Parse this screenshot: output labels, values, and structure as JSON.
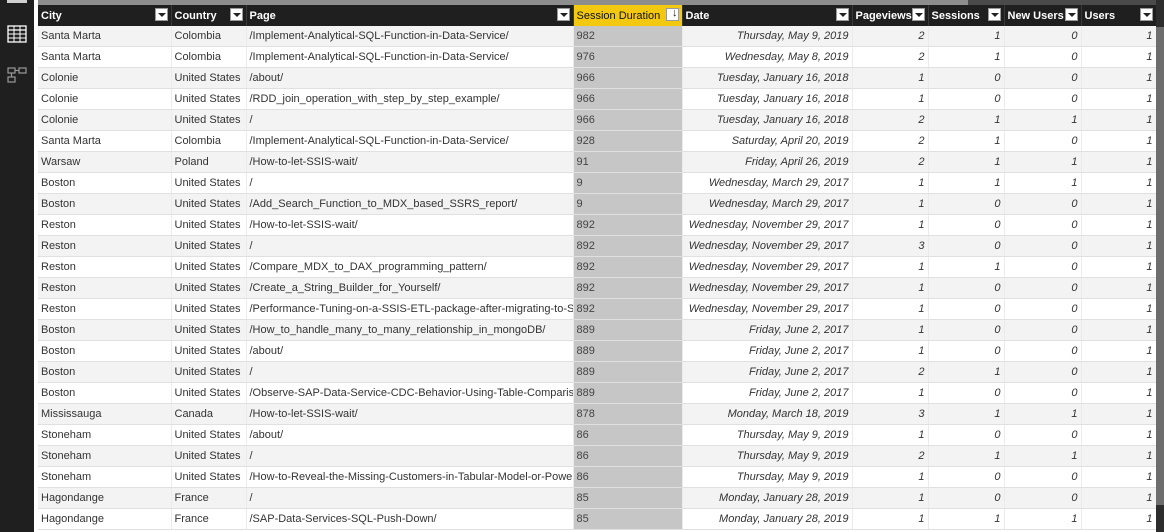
{
  "columns": [
    {
      "key": "city",
      "label": "City",
      "width": 133
    },
    {
      "key": "country",
      "label": "Country",
      "width": 75
    },
    {
      "key": "page",
      "label": "Page",
      "width": 327
    },
    {
      "key": "session_duration",
      "label": "Session Duration",
      "width": 109
    },
    {
      "key": "date",
      "label": "Date",
      "width": 170
    },
    {
      "key": "pageviews",
      "label": "Pageviews",
      "width": 76
    },
    {
      "key": "sessions",
      "label": "Sessions",
      "width": 76
    },
    {
      "key": "new_users",
      "label": "New Users",
      "width": 77
    },
    {
      "key": "users",
      "label": "Users",
      "width": 75
    }
  ],
  "sorted_column": "session_duration",
  "sort_direction": "descending",
  "rows": [
    [
      "Santa Marta",
      "Colombia",
      "/Implement-Analytical-SQL-Function-in-Data-Service/",
      "982",
      "Thursday, May 9, 2019",
      "2",
      "1",
      "0",
      "1"
    ],
    [
      "Santa Marta",
      "Colombia",
      "/Implement-Analytical-SQL-Function-in-Data-Service/",
      "976",
      "Wednesday, May 8, 2019",
      "2",
      "1",
      "0",
      "1"
    ],
    [
      "Colonie",
      "United States",
      "/about/",
      "966",
      "Tuesday, January 16, 2018",
      "1",
      "0",
      "0",
      "1"
    ],
    [
      "Colonie",
      "United States",
      "/RDD_join_operation_with_step_by_step_example/",
      "966",
      "Tuesday, January 16, 2018",
      "1",
      "0",
      "0",
      "1"
    ],
    [
      "Colonie",
      "United States",
      "/",
      "966",
      "Tuesday, January 16, 2018",
      "2",
      "1",
      "1",
      "1"
    ],
    [
      "Santa Marta",
      "Colombia",
      "/Implement-Analytical-SQL-Function-in-Data-Service/",
      "928",
      "Saturday, April 20, 2019",
      "2",
      "1",
      "0",
      "1"
    ],
    [
      "Warsaw",
      "Poland",
      "/How-to-let-SSIS-wait/",
      "91",
      "Friday, April 26, 2019",
      "2",
      "1",
      "1",
      "1"
    ],
    [
      "Boston",
      "United States",
      "/",
      "9",
      "Wednesday, March 29, 2017",
      "1",
      "1",
      "1",
      "1"
    ],
    [
      "Boston",
      "United States",
      "/Add_Search_Function_to_MDX_based_SSRS_report/",
      "9",
      "Wednesday, March 29, 2017",
      "1",
      "0",
      "0",
      "1"
    ],
    [
      "Reston",
      "United States",
      "/How-to-let-SSIS-wait/",
      "892",
      "Wednesday, November 29, 2017",
      "1",
      "0",
      "0",
      "1"
    ],
    [
      "Reston",
      "United States",
      "/",
      "892",
      "Wednesday, November 29, 2017",
      "3",
      "0",
      "0",
      "1"
    ],
    [
      "Reston",
      "United States",
      "/Compare_MDX_to_DAX_programming_pattern/",
      "892",
      "Wednesday, November 29, 2017",
      "1",
      "1",
      "0",
      "1"
    ],
    [
      "Reston",
      "United States",
      "/Create_a_String_Builder_for_Yourself/",
      "892",
      "Wednesday, November 29, 2017",
      "1",
      "0",
      "0",
      "1"
    ],
    [
      "Reston",
      "United States",
      "/Performance-Tuning-on-a-SSIS-ETL-package-after-migrating-to-SC",
      "892",
      "Wednesday, November 29, 2017",
      "1",
      "0",
      "0",
      "1"
    ],
    [
      "Boston",
      "United States",
      "/How_to_handle_many_to_many_relationship_in_mongoDB/",
      "889",
      "Friday, June 2, 2017",
      "1",
      "0",
      "0",
      "1"
    ],
    [
      "Boston",
      "United States",
      "/about/",
      "889",
      "Friday, June 2, 2017",
      "1",
      "0",
      "0",
      "1"
    ],
    [
      "Boston",
      "United States",
      "/",
      "889",
      "Friday, June 2, 2017",
      "2",
      "1",
      "0",
      "1"
    ],
    [
      "Boston",
      "United States",
      "/Observe-SAP-Data-Service-CDC-Behavior-Using-Table-Comparison",
      "889",
      "Friday, June 2, 2017",
      "1",
      "0",
      "0",
      "1"
    ],
    [
      "Mississauga",
      "Canada",
      "/How-to-let-SSIS-wait/",
      "878",
      "Monday, March 18, 2019",
      "3",
      "1",
      "1",
      "1"
    ],
    [
      "Stoneham",
      "United States",
      "/about/",
      "86",
      "Thursday, May 9, 2019",
      "1",
      "0",
      "0",
      "1"
    ],
    [
      "Stoneham",
      "United States",
      "/",
      "86",
      "Thursday, May 9, 2019",
      "2",
      "1",
      "1",
      "1"
    ],
    [
      "Stoneham",
      "United States",
      "/How-to-Reveal-the-Missing-Customers-in-Tabular-Model-or-Powe",
      "86",
      "Thursday, May 9, 2019",
      "1",
      "0",
      "0",
      "1"
    ],
    [
      "Hagondange",
      "France",
      "/",
      "85",
      "Monday, January 28, 2019",
      "1",
      "0",
      "0",
      "1"
    ],
    [
      "Hagondange",
      "France",
      "/SAP-Data-Services-SQL-Push-Down/",
      "85",
      "Monday, January 28, 2019",
      "1",
      "1",
      "1",
      "1"
    ]
  ],
  "sidebar": {
    "items": [
      {
        "icon": "data-view-icon"
      },
      {
        "icon": "model-view-icon"
      }
    ]
  }
}
